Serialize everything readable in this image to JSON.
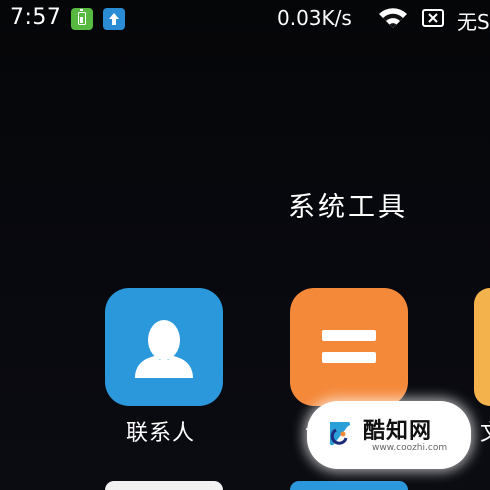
{
  "status_bar": {
    "time": "7:57",
    "net_speed": "0.03K/s",
    "carrier": "无S",
    "icons": [
      "battery-badge-icon",
      "upload-badge-icon",
      "wifi-icon",
      "no-sim-icon"
    ]
  },
  "folder": {
    "title": "系统工具",
    "apps": [
      {
        "name": "联系人",
        "icon": "contacts-icon",
        "color": "#2b98dc"
      },
      {
        "name": "",
        "icon": "calculator-icon",
        "color": "#f5893a"
      },
      {
        "name": "",
        "icon": "app-icon-partial",
        "color": "#f3b24b"
      }
    ],
    "partial_labels": {
      "second": "计",
      "third": "文"
    }
  },
  "watermark": {
    "name": "酷知网",
    "url": "www.coozhi.com"
  }
}
